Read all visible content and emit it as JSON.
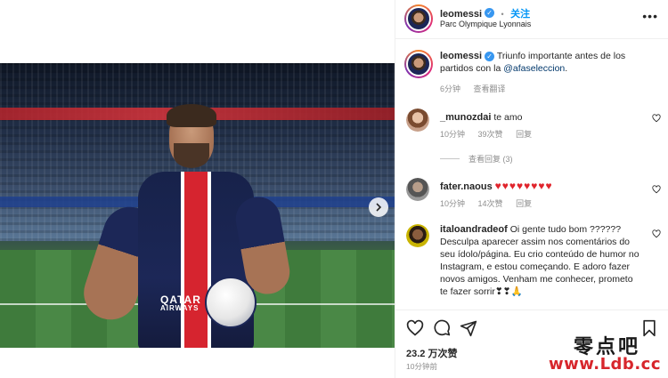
{
  "post": {
    "author": "leomessi",
    "follow_label": "关注",
    "separator": "•",
    "location": "Parc Olympique Lyonnais",
    "caption_text": "Triunfo importante antes de los partidos con la ",
    "caption_mention": "@afaseleccion",
    "caption_end": ".",
    "caption_time": "6分钟",
    "see_translation": "查看翻译",
    "photo_text": {
      "sponsor_top": "QATAR",
      "sponsor_bottom": "AIRWAYS"
    }
  },
  "comments": [
    {
      "username": "_munozdai",
      "text": "te amo",
      "time": "10分钟",
      "likes": "39次赞",
      "reply": "回复",
      "view_replies": "查看回复 (3)"
    },
    {
      "username": "fater.naous",
      "text": "♥♥♥♥♥♥♥♥",
      "time": "10分钟",
      "likes": "14次赞",
      "reply": "回复"
    },
    {
      "username": "italoandradeof",
      "text": "Oi gente tudo bom ?????? Desculpa aparecer assim nos comentários do seu ídolo/página. Eu crio conteúdo de humor no Instagram, e estou começando. E adoro fazer novos amigos. Venham me conhecer, prometo te fazer sorrir❣❣🙏",
      "time": "",
      "likes": "",
      "reply": ""
    }
  ],
  "footer": {
    "likes": "23.2 万次赞",
    "posted": "10分钟前"
  },
  "watermark": {
    "chinese": "零点吧",
    "url": "www.Ldb.cc"
  },
  "icons": {
    "more": "more-horizontal-icon",
    "verified": "verified-badge-icon",
    "heart": "heart-icon",
    "comment": "comment-icon",
    "share": "paper-plane-icon",
    "save": "bookmark-icon",
    "next": "chevron-right-icon"
  },
  "colors": {
    "accent": "#0095f6",
    "verified": "#3897f0",
    "heart_red": "#e0242c",
    "text": "#262626",
    "muted": "#8e8e8e",
    "link": "#00376b",
    "watermark_red": "#d7262c"
  }
}
